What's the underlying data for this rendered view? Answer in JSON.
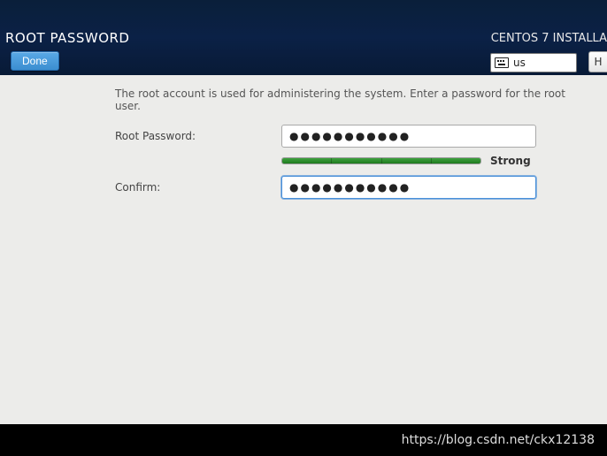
{
  "header": {
    "title": "ROOT PASSWORD",
    "subtitle": "CENTOS 7 INSTALLA",
    "done_label": "Done",
    "keyboard_layout": "us",
    "help_label": "H"
  },
  "form": {
    "instruction": "The root account is used for administering the system.   Enter a password for the root user.",
    "password_label": "Root Password:",
    "password_value": "●●●●●●●●●●●",
    "confirm_label": "Confirm:",
    "confirm_value": "●●●●●●●●●●●",
    "strength_label": "Strong",
    "strength_percent": 100
  },
  "watermark": "https://blog.csdn.net/ckx12138"
}
